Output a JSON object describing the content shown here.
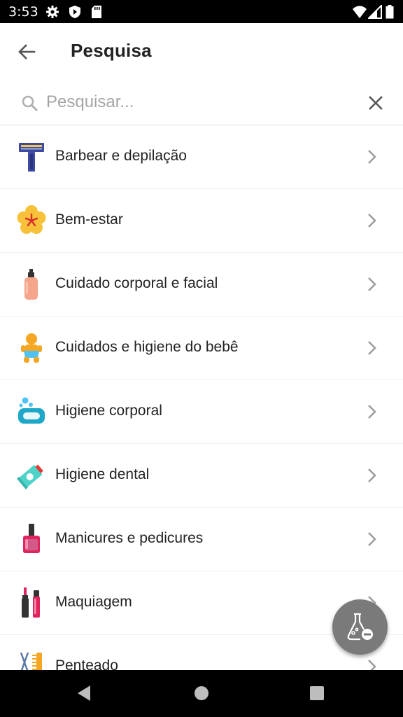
{
  "status_bar": {
    "time": "3:53",
    "left_icons": [
      "gear-icon",
      "shield-play-icon",
      "sd-card-icon"
    ],
    "right_icons": [
      "wifi-icon",
      "signal-icon",
      "battery-icon"
    ]
  },
  "app_bar": {
    "title": "Pesquisa",
    "back_icon": "arrow-left-icon"
  },
  "search": {
    "placeholder": "Pesquisar...",
    "value": "",
    "clear_icon": "close-icon"
  },
  "categories": [
    {
      "label": "Barbear e depilação",
      "icon": "razor-icon"
    },
    {
      "label": "Bem-estar",
      "icon": "flower-icon"
    },
    {
      "label": "Cuidado corporal e facial",
      "icon": "lotion-bottle-icon"
    },
    {
      "label": "Cuidados e higiene do bebê",
      "icon": "baby-icon"
    },
    {
      "label": "Higiene corporal",
      "icon": "soap-icon"
    },
    {
      "label": "Higiene dental",
      "icon": "toothpaste-icon"
    },
    {
      "label": "Manicures e pedicures",
      "icon": "nail-polish-icon"
    },
    {
      "label": "Maquiagem",
      "icon": "lipstick-icon"
    },
    {
      "label": "Penteado",
      "icon": "comb-scissors-icon"
    }
  ],
  "fab": {
    "icon": "flask-remove-icon"
  },
  "nav_bar": {
    "icons": [
      "back-triangle-icon",
      "home-circle-icon",
      "recents-square-icon"
    ]
  },
  "colors": {
    "status_bar": "#000000",
    "background": "#ffffff",
    "text": "#222222",
    "placeholder": "#a5a5a5",
    "chevron": "#9e9e9e",
    "fab": "#7a7a7a"
  }
}
